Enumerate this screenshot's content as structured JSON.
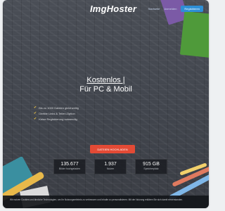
{
  "header": {
    "logo": "ImgHoster",
    "nav": [
      "Startseite",
      "Anmelden",
      "Registrieren"
    ]
  },
  "hero": {
    "title_line1": "Kostenlos |",
    "title_line2": "Für PC & Mobil"
  },
  "features": [
    "Bis zu 1000 Dateien gleichzeitig",
    "Direkte Links & Teilen-Option",
    "Keine Registrierung notwendig"
  ],
  "cta_label": "DATEIEN HOCHLADEN",
  "stats": [
    {
      "value": "135.677",
      "label": "Bilder hochgeladen"
    },
    {
      "value": "1.937",
      "label": "Nutzer"
    },
    {
      "value": "915 GB",
      "label": "Speicherplatz"
    }
  ],
  "cookie_text": "Wir nutzen Cookies und ähnliche Technologien, um Ihr Nutzungserlebnis zu verbessern und Inhalte zu personalisieren. Mit der Nutzung erklären Sie sich damit einverstanden."
}
